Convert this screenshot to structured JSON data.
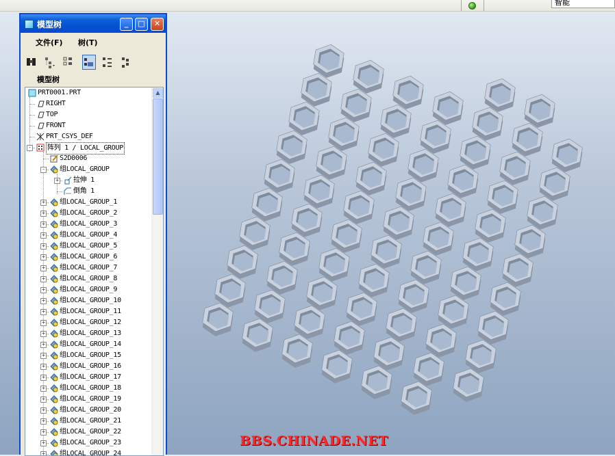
{
  "status_bar": {
    "smart_filter": "智能"
  },
  "model_tree": {
    "window_title": "模型树",
    "menu": {
      "file": "文件(F)",
      "tree": "树(T)"
    },
    "panel_label": "模型树",
    "items": [
      {
        "label": "PRT0001.PRT",
        "icon": "part-icon",
        "indent": 0
      },
      {
        "label": "RIGHT",
        "icon": "datum-plane-icon",
        "indent": 1
      },
      {
        "label": "TOP",
        "icon": "datum-plane-icon",
        "indent": 1
      },
      {
        "label": "FRONT",
        "icon": "datum-plane-icon",
        "indent": 1
      },
      {
        "label": "PRT_CSYS_DEF",
        "icon": "csys-icon",
        "indent": 1
      },
      {
        "label": "阵列 1 / LOCAL_GROUP",
        "icon": "pattern-icon",
        "indent": 1,
        "expander": "-"
      },
      {
        "label": "S2D0006",
        "icon": "sketch-icon",
        "indent": 2
      },
      {
        "label": "组LOCAL_GROUP",
        "icon": "group-icon",
        "indent": 2,
        "expander": "-"
      },
      {
        "label": "拉伸 1",
        "icon": "extrude-icon",
        "indent": 3,
        "expander": "+"
      },
      {
        "label": "倒角 1",
        "icon": "chamfer-icon",
        "indent": 3
      },
      {
        "label": "组LOCAL_GROUP_1",
        "icon": "group-icon",
        "indent": 2,
        "expander": "+"
      },
      {
        "label": "组LOCAL_GROUP_2",
        "icon": "group-icon",
        "indent": 2,
        "expander": "+"
      },
      {
        "label": "组LOCAL_GROUP_3",
        "icon": "group-icon",
        "indent": 2,
        "expander": "+"
      },
      {
        "label": "组LOCAL_GROUP_4",
        "icon": "group-icon",
        "indent": 2,
        "expander": "+"
      },
      {
        "label": "组LOCAL_GROUP_5",
        "icon": "group-icon",
        "indent": 2,
        "expander": "+"
      },
      {
        "label": "组LOCAL_GROUP_6",
        "icon": "group-icon",
        "indent": 2,
        "expander": "+"
      },
      {
        "label": "组LOCAL_GROUP_7",
        "icon": "group-icon",
        "indent": 2,
        "expander": "+"
      },
      {
        "label": "组LOCAL_GROUP_8",
        "icon": "group-icon",
        "indent": 2,
        "expander": "+"
      },
      {
        "label": "组LOCAL_GROUP_9",
        "icon": "group-icon",
        "indent": 2,
        "expander": "+"
      },
      {
        "label": "组LOCAL_GROUP_10",
        "icon": "group-icon",
        "indent": 2,
        "expander": "+"
      },
      {
        "label": "组LOCAL_GROUP_11",
        "icon": "group-icon",
        "indent": 2,
        "expander": "+"
      },
      {
        "label": "组LOCAL_GROUP_12",
        "icon": "group-icon",
        "indent": 2,
        "expander": "+"
      },
      {
        "label": "组LOCAL_GROUP_13",
        "icon": "group-icon",
        "indent": 2,
        "expander": "+"
      },
      {
        "label": "组LOCAL_GROUP_14",
        "icon": "group-icon",
        "indent": 2,
        "expander": "+"
      },
      {
        "label": "组LOCAL_GROUP_15",
        "icon": "group-icon",
        "indent": 2,
        "expander": "+"
      },
      {
        "label": "组LOCAL_GROUP_16",
        "icon": "group-icon",
        "indent": 2,
        "expander": "+"
      },
      {
        "label": "组LOCAL_GROUP_17",
        "icon": "group-icon",
        "indent": 2,
        "expander": "+"
      },
      {
        "label": "组LOCAL_GROUP_18",
        "icon": "group-icon",
        "indent": 2,
        "expander": "+"
      },
      {
        "label": "组LOCAL_GROUP_19",
        "icon": "group-icon",
        "indent": 2,
        "expander": "+"
      },
      {
        "label": "组LOCAL_GROUP_20",
        "icon": "group-icon",
        "indent": 2,
        "expander": "+"
      },
      {
        "label": "组LOCAL_GROUP_21",
        "icon": "group-icon",
        "indent": 2,
        "expander": "+"
      },
      {
        "label": "组LOCAL_GROUP_22",
        "icon": "group-icon",
        "indent": 2,
        "expander": "+"
      },
      {
        "label": "组LOCAL_GROUP_23",
        "icon": "group-icon",
        "indent": 2,
        "expander": "+"
      },
      {
        "label": "组LOCAL_GROUP_24",
        "icon": "group-icon",
        "indent": 2,
        "expander": "+"
      }
    ]
  },
  "viewport": {
    "model": "hexagon-honeycomb-plate"
  },
  "watermark": "BBS.CHINADE.NET",
  "colors": {
    "titlebar": "#0a4ad4",
    "hex_top": "#c9d2de",
    "hex_side": "#8b97a8",
    "watermark": "#ff2a2a"
  }
}
